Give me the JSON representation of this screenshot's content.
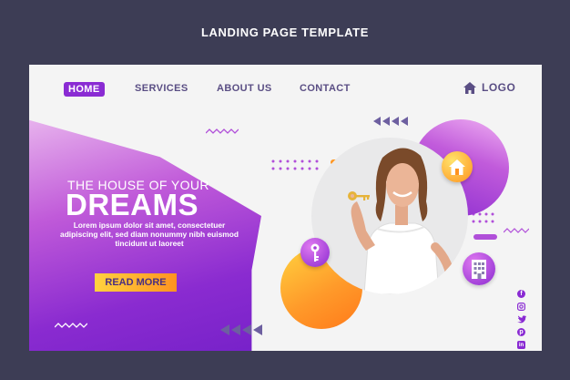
{
  "page": {
    "title": "LANDING PAGE TEMPLATE"
  },
  "nav": {
    "items": [
      {
        "label": "HOME",
        "active": true
      },
      {
        "label": "SERVICES"
      },
      {
        "label": "ABOUT US"
      },
      {
        "label": "CONTACT"
      }
    ],
    "logo_label": "LOGO",
    "logo_icon": "home-icon"
  },
  "hero": {
    "subtitle": "THE HOUSE OF YOUR",
    "title": "DREAMS",
    "body": "Lorem ipsum dolor sit amet, consectetuer adipiscing elit, sed diam nonummy nibh euismod tincidunt ut laoreet",
    "button_label": "READ MORE"
  },
  "colors": {
    "purple": "#8a2bd3",
    "orange": "#ff9320",
    "yellow": "#ffd23f",
    "text": "#5a4e84"
  },
  "feature_icons": [
    "home-icon",
    "key-icon",
    "building-icon"
  ],
  "social_icons": [
    "facebook-icon",
    "instagram-icon",
    "twitter-icon",
    "pinterest-icon",
    "linkedin-icon"
  ]
}
